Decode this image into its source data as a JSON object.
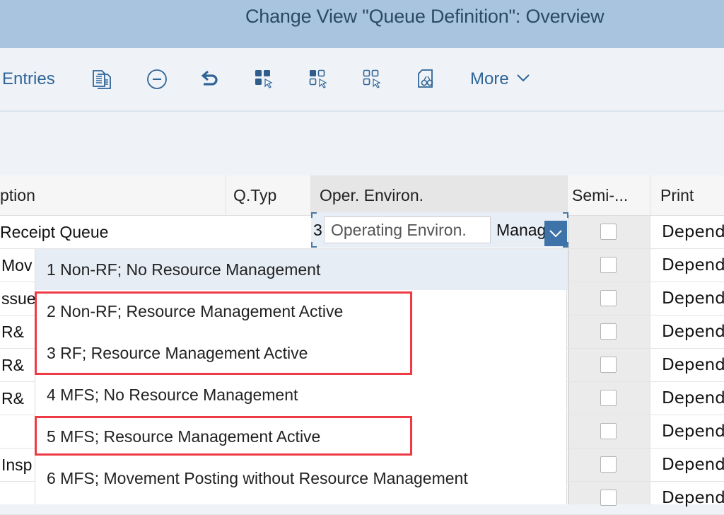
{
  "window": {
    "title": "Change View \"Queue Definition\": Overview"
  },
  "toolbar": {
    "entries_label": "Entries",
    "more_label": "More",
    "icons": [
      "copy-icon",
      "delete-icon",
      "undo-icon",
      "select-all-icon",
      "select-block-icon",
      "deselect-all-icon",
      "print-preview-icon"
    ]
  },
  "table": {
    "headers": {
      "description": "ption",
      "qtyp": "Q.Typ",
      "oper_environ": "Oper. Environ.",
      "semi": "Semi-...",
      "print": "Print"
    },
    "rows": [
      {
        "description": "Receipt Queue",
        "qtyp": "",
        "semi_checked": false,
        "print": "Depend"
      },
      {
        "description": "Mov",
        "qtyp": "",
        "semi_checked": false,
        "print": "Depend"
      },
      {
        "description": "ssue",
        "qtyp": "",
        "semi_checked": false,
        "print": "Depend"
      },
      {
        "description": "R&",
        "qtyp": "",
        "semi_checked": false,
        "print": "Depend"
      },
      {
        "description": "R&",
        "qtyp": "",
        "semi_checked": false,
        "print": "Depend"
      },
      {
        "description": "R&",
        "qtyp": "",
        "semi_checked": false,
        "print": "Depend"
      },
      {
        "description": "",
        "qtyp": "",
        "semi_checked": false,
        "print": "Depend"
      },
      {
        "description": "Insp",
        "qtyp": "",
        "semi_checked": false,
        "print": "Depend"
      },
      {
        "description": "",
        "qtyp": "",
        "semi_checked": false,
        "print": "Depend"
      }
    ]
  },
  "oper_environ_field": {
    "value_prefix": "3",
    "value_tail": "Manage",
    "tooltip": "Operating Environ."
  },
  "dropdown": {
    "options": [
      {
        "label": "1 Non-RF; No Resource Management",
        "highlighted": true
      },
      {
        "label": "2 Non-RF; Resource Management Active",
        "highlighted": false
      },
      {
        "label": "3 RF; Resource Management Active",
        "highlighted": false
      },
      {
        "label": "4 MFS; No Resource Management",
        "highlighted": false
      },
      {
        "label": "5 MFS; Resource Management Active",
        "highlighted": false
      },
      {
        "label": "6 MFS; Movement Posting without Resource Management",
        "highlighted": false
      }
    ]
  },
  "annotations": {
    "color": "#ee3a44",
    "boxes": [
      {
        "covers_options": [
          2,
          3
        ]
      },
      {
        "covers_options": [
          5
        ]
      }
    ]
  }
}
